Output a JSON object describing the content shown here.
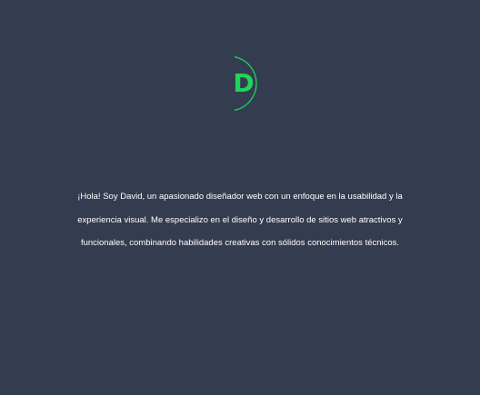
{
  "logo": {
    "letter": "D",
    "color": "#1dd65b"
  },
  "intro": {
    "text": "¡Hola! Soy David, un apasionado diseñador web con un enfoque en la usabilidad y la experiencia visual. Me especializo en el diseño y desarrollo de sitios web atractivos y funcionales, combinando habilidades creativas con sólidos conocimientos técnicos."
  },
  "colors": {
    "background": "#343c50",
    "accent": "#1dd65b",
    "text": "#ffffff"
  }
}
